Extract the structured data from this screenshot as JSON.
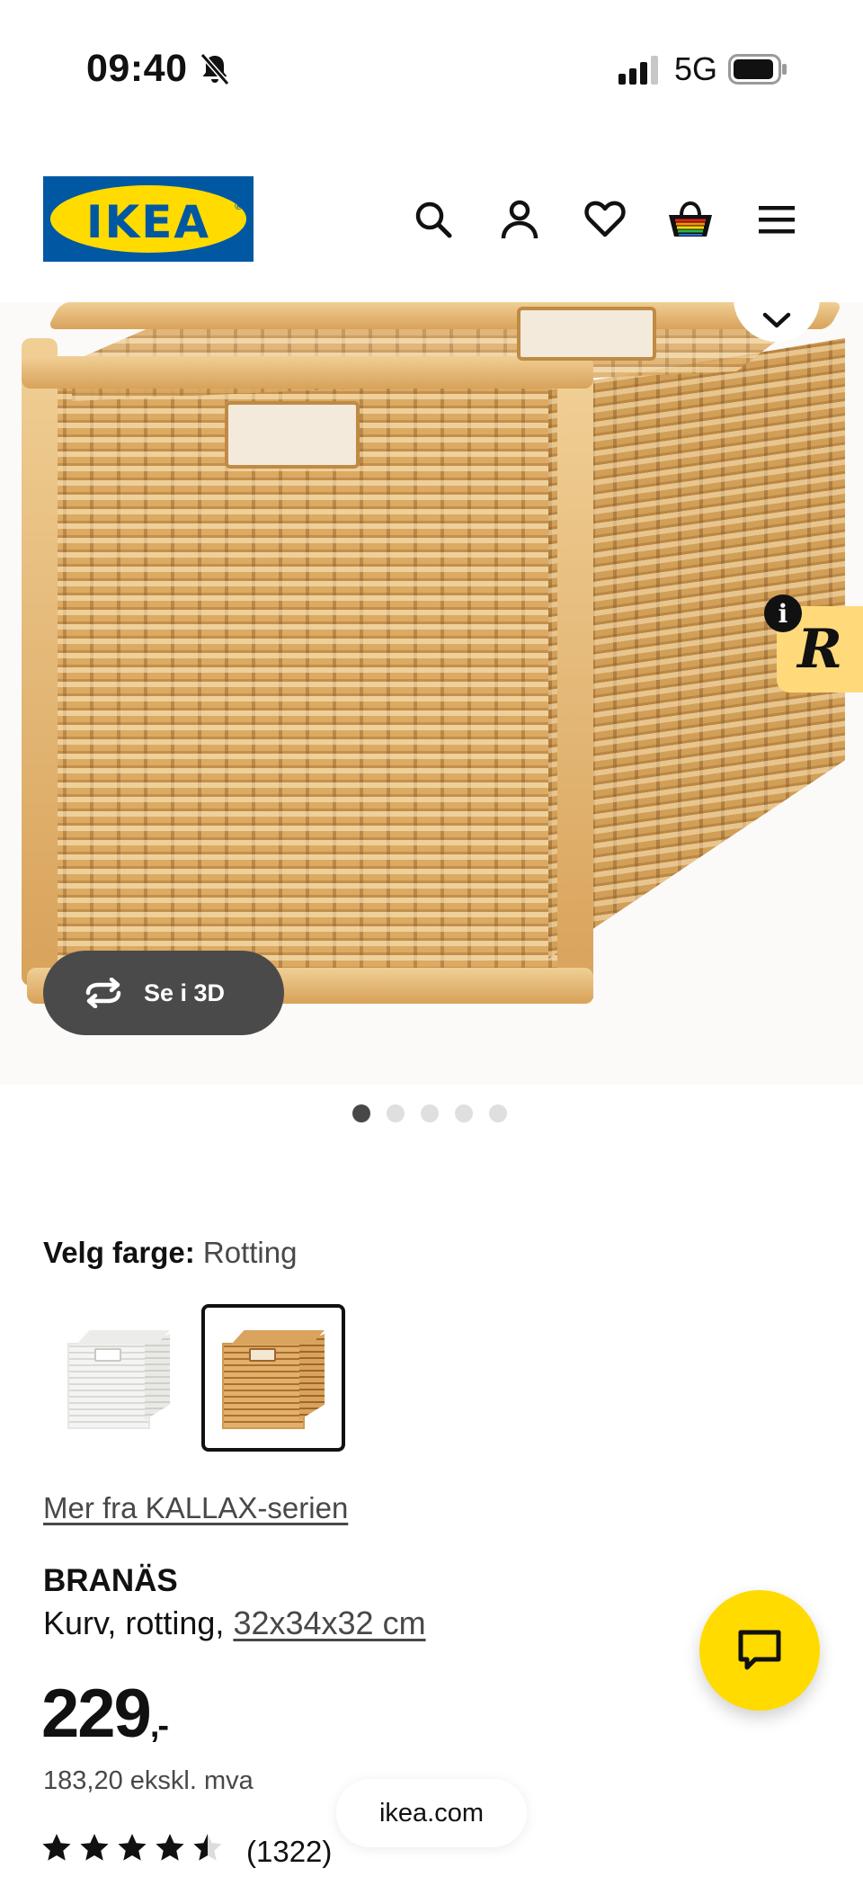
{
  "status_bar": {
    "time": "09:40",
    "network": "5G",
    "icons": [
      "bell-muted-icon",
      "signal-icon",
      "battery-icon"
    ]
  },
  "header": {
    "logo_text": "IKEA",
    "icons": [
      "search-icon",
      "account-icon",
      "heart-icon",
      "cart-icon",
      "menu-icon"
    ]
  },
  "gallery": {
    "view_3d_label": "Se i 3D",
    "image_count": 5,
    "active_index": 0,
    "badge_letter": "R",
    "info_letter": "i"
  },
  "color_picker": {
    "label": "Velg farge:",
    "selected_value": "Rotting",
    "options": [
      "white",
      "rattan"
    ],
    "selected_index": 1
  },
  "series_link": "Mer fra KALLAX-serien",
  "product": {
    "name": "BRANÄS",
    "description_prefix": "Kurv, rotting,",
    "dimensions": "32x34x32 cm",
    "price_main": "229",
    "price_suffix": ",-",
    "price_ex_vat": "183,20 ekskl. mva",
    "rating": 4.5,
    "rating_count": "(1322)"
  },
  "browser": {
    "url": "ikea.com"
  },
  "colors": {
    "ikea_blue": "#0058a3",
    "ikea_yellow": "#ffdb00",
    "dark_pill": "#4a4a4a"
  }
}
